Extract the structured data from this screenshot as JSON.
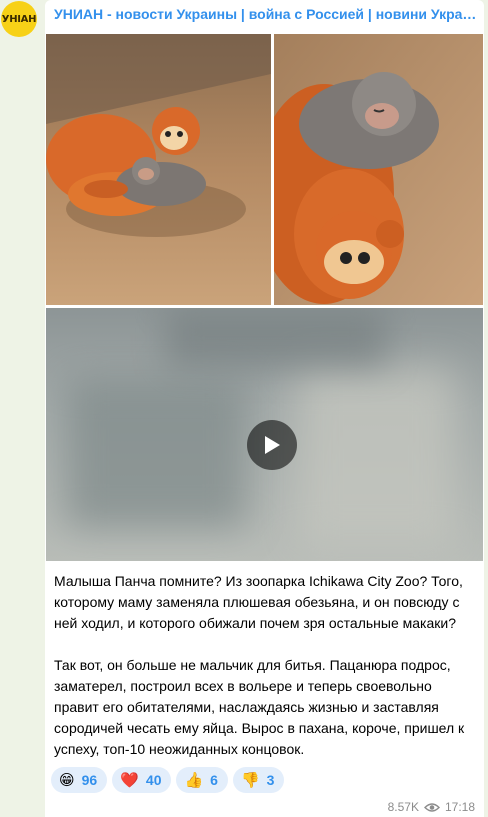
{
  "channel": {
    "avatar_text": "УНІАН",
    "name": "УНИАН - новости Украины | война с Россией | новини України | Україна"
  },
  "media": {
    "photo1_icon": "monkey-with-plush-photo",
    "photo2_icon": "sleeping-monkey-photo",
    "video_icon": "play-icon"
  },
  "message": {
    "paragraph1": "Малыша Панча помните? Из зоопарка Ichikawa City Zoo? Того, которому маму заменяла плюшевая обезьяна, и он повсюду с ней ходил, и которого обижали почем зря остальные макаки?",
    "paragraph2": "Так вот, он больше не мальчик для битья. Пацанюра подрос, заматерел, построил всех в вольере и теперь своевольно правит его обитателями, наслаждаясь жизнью и заставляя сородичей чесать ему яйца. Вырос в пахана, короче, пришел к успеху, топ-10 неожиданных концовок."
  },
  "reactions": [
    {
      "emoji": "😁",
      "count": "96"
    },
    {
      "emoji": "❤️",
      "count": "40"
    },
    {
      "emoji": "👍",
      "count": "6"
    },
    {
      "emoji": "👎",
      "count": "3"
    }
  ],
  "meta": {
    "views": "8.57K",
    "time": "17:18",
    "views_icon": "eye-icon"
  },
  "colors": {
    "accent": "#3390ec",
    "chat_background": "#eef3e6",
    "reaction_background": "#e3eefb"
  }
}
